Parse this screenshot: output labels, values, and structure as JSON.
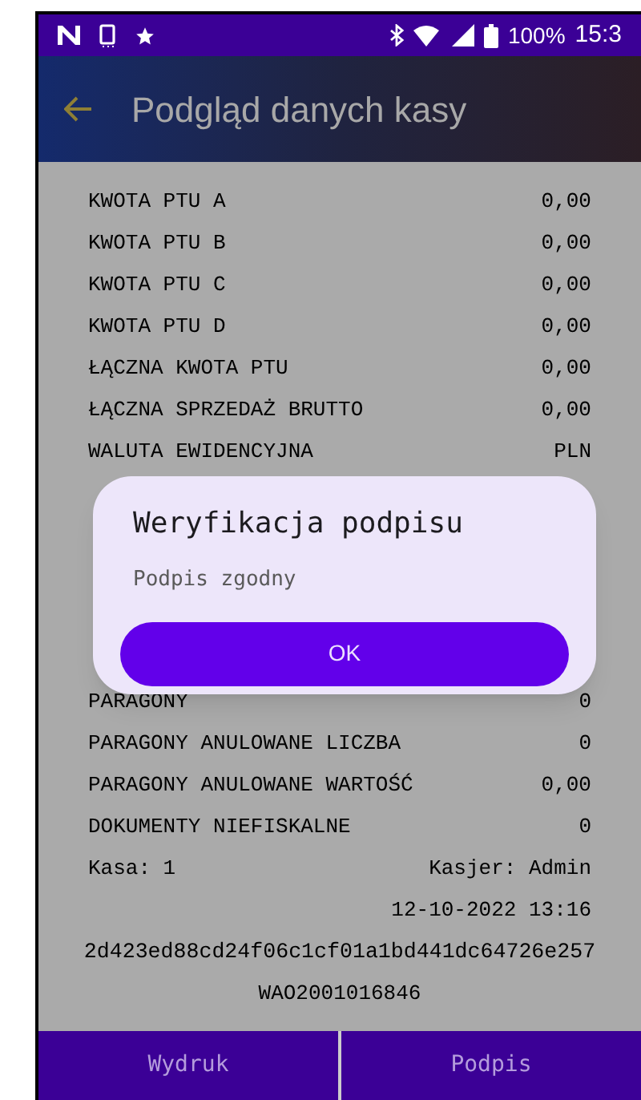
{
  "status_bar": {
    "battery": "100%",
    "time": "15:3"
  },
  "app_bar": {
    "title": "Podgląd danych kasy"
  },
  "receipt": {
    "rows_above": [
      {
        "label": "KWOTA PTU A",
        "value": "0,00"
      },
      {
        "label": "KWOTA PTU B",
        "value": "0,00"
      },
      {
        "label": "KWOTA PTU C",
        "value": "0,00"
      },
      {
        "label": "KWOTA PTU D",
        "value": "0,00"
      },
      {
        "label": "ŁĄCZNA KWOTA PTU",
        "value": "0,00"
      },
      {
        "label": "ŁĄCZNA SPRZEDAŻ BRUTTO",
        "value": "0,00"
      },
      {
        "label": "WALUTA EWIDENCYJNA",
        "value": "PLN"
      }
    ],
    "rows_below": [
      {
        "label": "PARAGONY",
        "value": "0"
      },
      {
        "label": "PARAGONY ANULOWANE LICZBA",
        "value": "0"
      },
      {
        "label": "PARAGONY ANULOWANE WARTOŚĆ",
        "value": "0,00"
      },
      {
        "label": "DOKUMENTY NIEFISKALNE",
        "value": "0"
      },
      {
        "label": "Kasa: 1",
        "value": "Kasjer: Admin"
      }
    ],
    "date": "12-10-2022 13:16",
    "hash": "2d423ed88cd24f06c1cf01a1bd441dc64726e257",
    "number": "WAO2001016846"
  },
  "dialog": {
    "title": "Weryfikacja podpisu",
    "message": "Podpis zgodny",
    "button": "OK"
  },
  "bottom_buttons": [
    "Wydruk",
    "Podpis"
  ]
}
